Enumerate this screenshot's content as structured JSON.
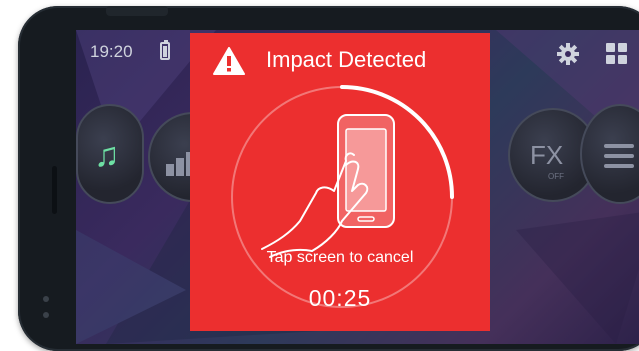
{
  "status_bar": {
    "time": "19:20",
    "battery_icon": "battery-icon",
    "settings_icon": "gear-icon",
    "apps_icon": "grid-icon"
  },
  "controls": {
    "music_icon": "music-note-icon",
    "equalizer_icon": "equalizer-icon",
    "fx_label": "FX",
    "fx_state": "OFF",
    "menu_icon": "menu-icon"
  },
  "alert": {
    "title": "Impact Detected",
    "instruction": "Tap screen to cancel",
    "countdown": "00:25",
    "countdown_progress": 0.25,
    "icon": "warning-triangle-icon",
    "illustration": "hand-tapping-phone",
    "background_color": "#ec2f2f"
  }
}
